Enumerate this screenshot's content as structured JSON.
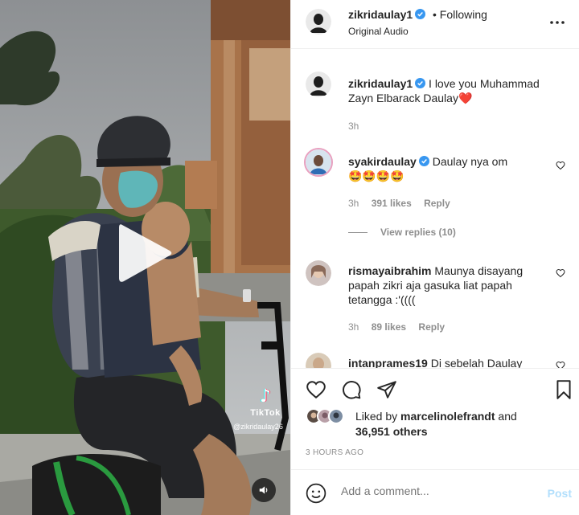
{
  "header": {
    "username": "zikridaulay1",
    "separator": "•",
    "follow_status": "Following",
    "audio": "Original Audio",
    "more_icon": "more-horizontal-icon"
  },
  "caption": {
    "username": "zikridaulay1",
    "text": "I love you Muhammad Zayn Elbarack Daulay",
    "emoji": "❤️",
    "time": "3h"
  },
  "comments": [
    {
      "username": "syakirdaulay",
      "verified": true,
      "text": "Daulay nya om",
      "emoji_line": "🤩🤩🤩🤩",
      "time": "3h",
      "likes": "391 likes",
      "reply": "Reply",
      "view_replies": "View replies (10)"
    },
    {
      "username": "rismayaibrahim",
      "text": "Maunya disayang papah zikri aja gasuka liat papah tetangga :'((((",
      "time": "3h",
      "likes": "89 likes",
      "reply": "Reply"
    },
    {
      "username": "intanprames19",
      "text": "Di sebelah Daulay"
    }
  ],
  "actions": {
    "like_icon": "heart-icon",
    "comment_icon": "comment-icon",
    "share_icon": "share-icon",
    "save_icon": "bookmark-icon"
  },
  "likes": {
    "prefix": "Liked by",
    "user": "marcelinolefrandt",
    "conj": "and",
    "others": "36,951 others"
  },
  "timestamp": "3 HOURS AGO",
  "add_comment": {
    "placeholder": "Add a comment...",
    "post_label": "Post",
    "emoji_icon": "smiley-icon"
  },
  "video": {
    "watermark_name": "TikTok",
    "watermark_handle": "@zikridaulay26",
    "play_icon": "play-icon",
    "mute_icon": "speaker-icon"
  },
  "colors": {
    "verified": "#3897f0",
    "heart": "#ed4956",
    "post_disabled": "#b2dffc",
    "secondary_text": "#8e8e8e"
  }
}
